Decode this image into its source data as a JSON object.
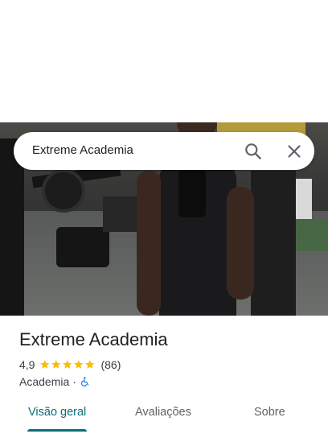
{
  "search": {
    "query": "Extreme Academia"
  },
  "place": {
    "name": "Extreme Academia",
    "rating": "4,9",
    "stars": 5,
    "review_count": "(86)",
    "category": "Academia",
    "separator": "·"
  },
  "tabs": [
    {
      "label": "Visão geral",
      "active": true
    },
    {
      "label": "Avaliações",
      "active": false
    },
    {
      "label": "Sobre",
      "active": false
    }
  ],
  "icons": {
    "search": "search-icon",
    "close": "close-icon",
    "star": "star-icon",
    "accessibility": "wheelchair-icon"
  },
  "colors": {
    "accent": "#0b6e78",
    "star": "#fbbc04",
    "accessibility": "#1a73e8"
  }
}
